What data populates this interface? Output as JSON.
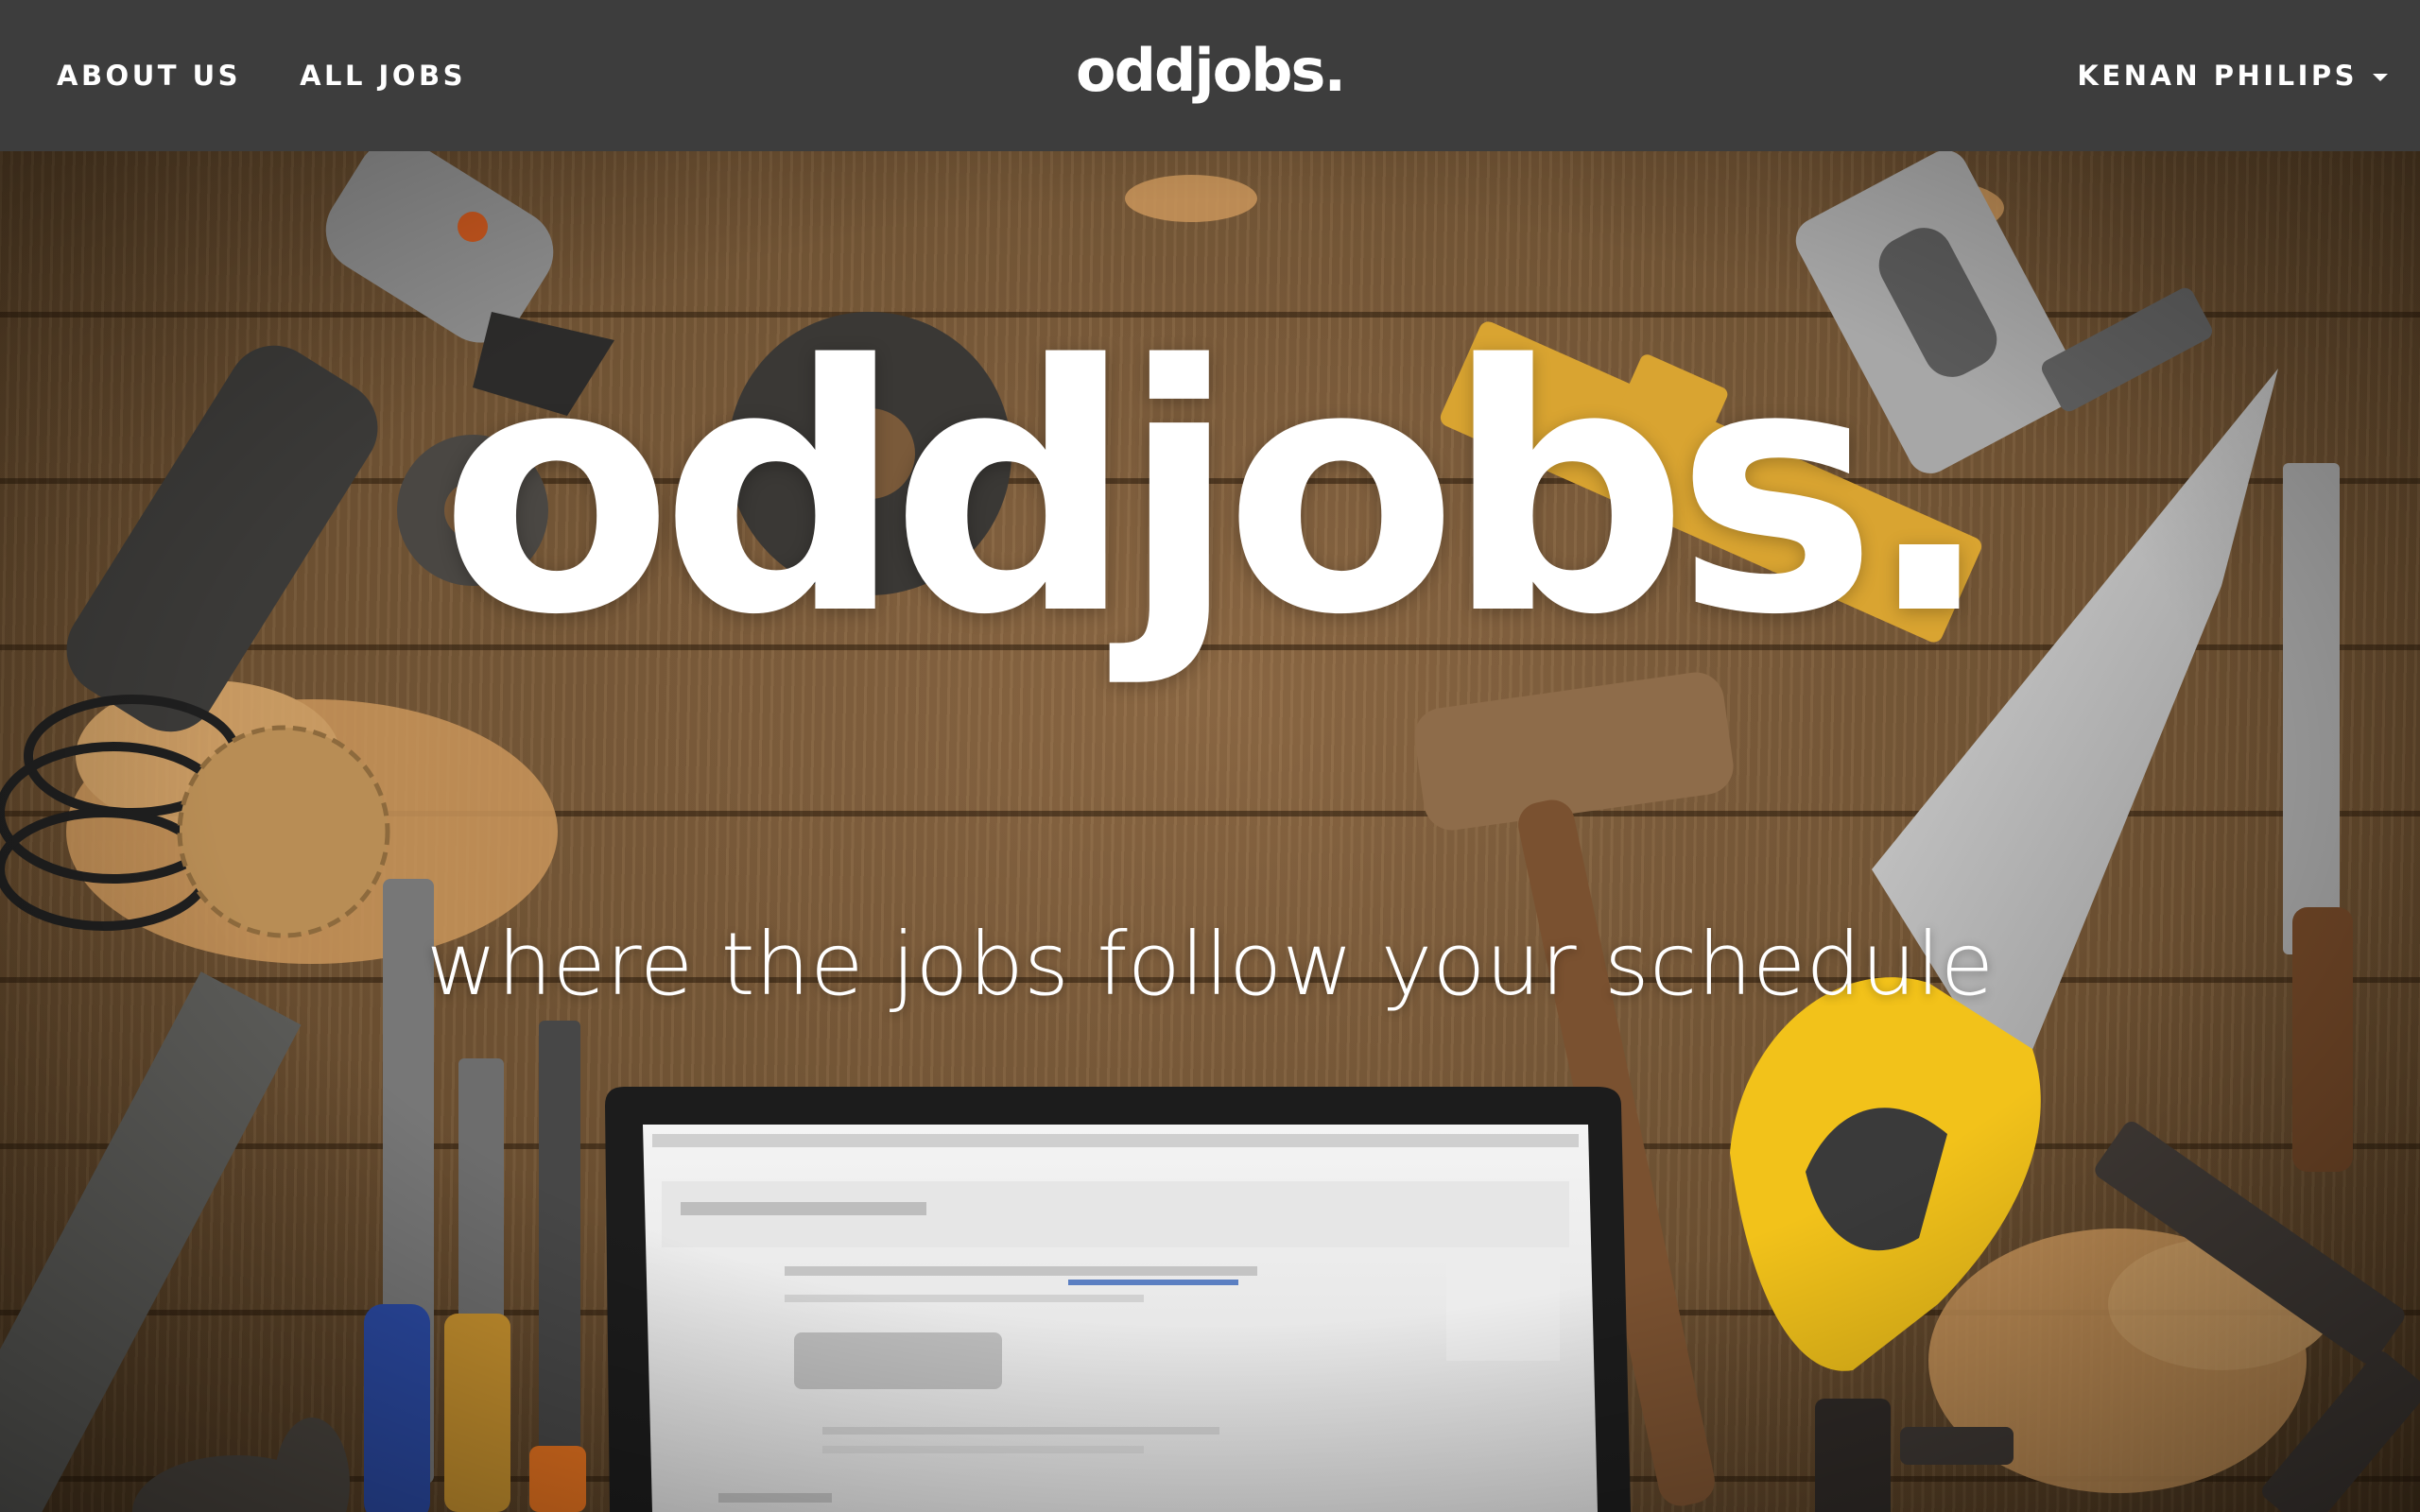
{
  "nav": {
    "links": [
      {
        "label": "ABOUT US"
      },
      {
        "label": "ALL JOBS"
      }
    ],
    "logo": "oddjobs.",
    "user_name": "KENAN PHILIPS"
  },
  "hero": {
    "title": "oddjobs.",
    "tagline": "where the jobs follow your schedule"
  },
  "colors": {
    "navbar_bg": "#3d3d3d",
    "text": "#ffffff",
    "wood": "#7a5a3a",
    "saw_handle": "#f2c21a",
    "level": "#d9a431"
  }
}
